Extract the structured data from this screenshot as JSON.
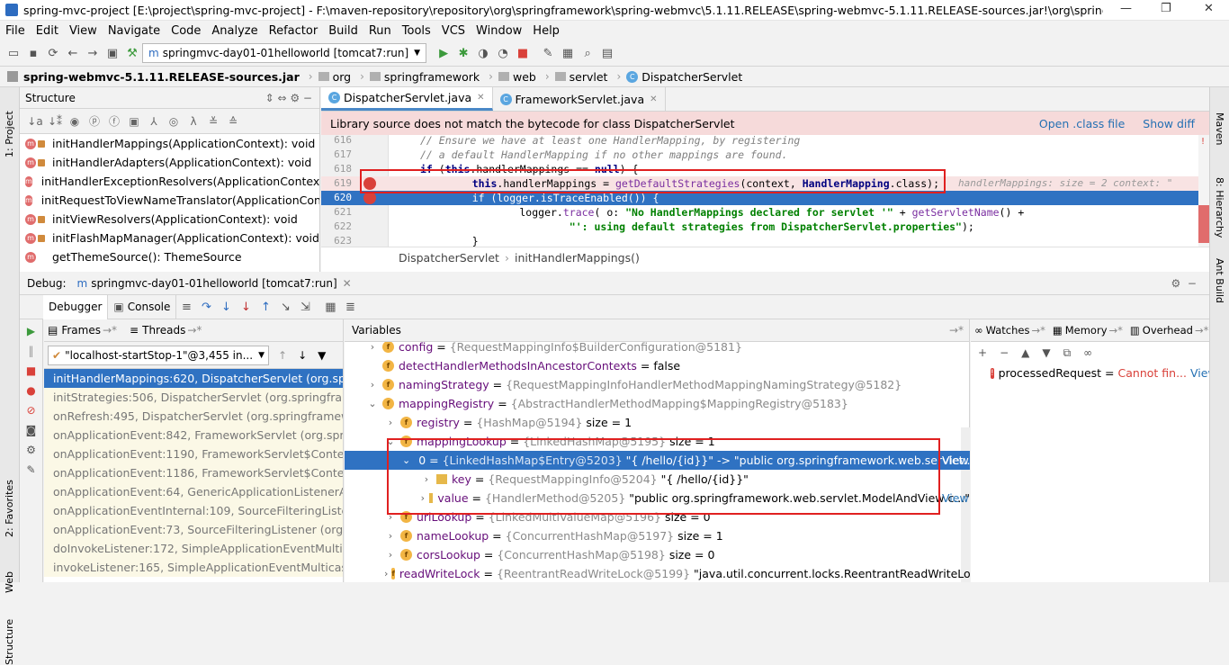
{
  "window": {
    "title": "spring-mvc-project [E:\\project\\spring-mvc-project] - F:\\maven-repository\\repository\\org\\springframework\\spring-webmvc\\5.1.11.RELEASE\\spring-webmvc-5.1.11.RELEASE-sources.jar!\\org\\springframewor...",
    "minimize": "—",
    "maximize": "❐",
    "close": "✕"
  },
  "menu": [
    "File",
    "Edit",
    "View",
    "Navigate",
    "Code",
    "Analyze",
    "Refactor",
    "Build",
    "Run",
    "Tools",
    "VCS",
    "Window",
    "Help"
  ],
  "toolbar": {
    "run_config": "springmvc-day01-01helloworld [tomcat7:run]"
  },
  "nav": {
    "jar": "spring-webmvc-5.1.11.RELEASE-sources.jar",
    "crumbs": [
      "org",
      "springframework",
      "web",
      "servlet",
      "DispatcherServlet"
    ]
  },
  "left_strip": {
    "project": "1: Project",
    "favorites": "2: Favorites",
    "web": "Web",
    "structure": "Structure"
  },
  "right_strip": {
    "maven": "Maven",
    "hierarchy": "8: Hierarchy",
    "ant": "Ant Build"
  },
  "structure": {
    "title": "Structure",
    "items": [
      "initHandlerMappings(ApplicationContext): void",
      "initHandlerAdapters(ApplicationContext): void",
      "initHandlerExceptionResolvers(ApplicationContext):",
      "initRequestToViewNameTranslator(ApplicationConte",
      "initViewResolvers(ApplicationContext): void",
      "initFlashMapManager(ApplicationContext): void",
      "getThemeSource(): ThemeSource"
    ]
  },
  "editor": {
    "tabs": [
      "DispatcherServlet.java",
      "FrameworkServlet.java"
    ],
    "banner": "Library source does not match the bytecode for class DispatcherServlet",
    "banner_links": [
      "Open .class file",
      "Show diff"
    ],
    "line_numbers": [
      "616",
      "617",
      "618",
      "619",
      "620",
      "621",
      "622",
      "623"
    ],
    "lines": [
      {
        "parts": [
          {
            "c": "cm",
            "t": "// Ensure we have at least one HandlerMapping, by registering"
          }
        ]
      },
      {
        "parts": [
          {
            "c": "cm",
            "t": "// a default HandlerMapping if no other mappings are found."
          }
        ]
      },
      {
        "parts": [
          {
            "c": "kw",
            "t": "if"
          },
          {
            "c": "",
            "t": " ("
          },
          {
            "c": "kw",
            "t": "this"
          },
          {
            "c": "",
            "t": ".handlerMappings == "
          },
          {
            "c": "kw",
            "t": "null"
          },
          {
            "c": "",
            "t": ") {"
          }
        ]
      },
      {
        "parts": [
          {
            "c": "",
            "t": "    "
          },
          {
            "c": "kw",
            "t": "this"
          },
          {
            "c": "",
            "t": ".handlerMappings = "
          },
          {
            "c": "fn",
            "t": "getDefaultStrategies"
          },
          {
            "c": "",
            "t": "(context, "
          },
          {
            "c": "kw",
            "t": "HandlerMapping"
          },
          {
            "c": "",
            "t": ".class);"
          }
        ]
      },
      {
        "parts": [
          {
            "c": "",
            "t": "    if (logger.isTraceEnabled()) {"
          }
        ]
      },
      {
        "parts": [
          {
            "c": "",
            "t": "        logger."
          },
          {
            "c": "fn",
            "t": "trace"
          },
          {
            "c": "",
            "t": "( o: "
          },
          {
            "c": "str",
            "t": "\"No HandlerMappings declared for servlet '\""
          },
          {
            "c": "",
            "t": " + "
          },
          {
            "c": "fn",
            "t": "getServletName"
          },
          {
            "c": "",
            "t": "() +"
          }
        ]
      },
      {
        "parts": [
          {
            "c": "str",
            "t": "                \"': using default strategies from DispatcherServlet.properties\""
          },
          {
            "c": "",
            "t": ");"
          }
        ]
      },
      {
        "parts": [
          {
            "c": "",
            "t": "    }"
          }
        ]
      }
    ],
    "inline_hint": "handlerMappings:  size = 2   context: \"",
    "breadcrumb": [
      "DispatcherServlet",
      "initHandlerMappings()"
    ]
  },
  "debug": {
    "label": "Debug:",
    "config": "springmvc-day01-01helloworld [tomcat7:run]",
    "tabs": [
      "Debugger",
      "Console"
    ],
    "frames_tab": "Frames",
    "threads_tab": "Threads",
    "thread": "\"localhost-startStop-1\"@3,455 in...",
    "frames": [
      "initHandlerMappings:620, DispatcherServlet (org.springf",
      "initStrategies:506, DispatcherServlet (org.springframew",
      "onRefresh:495, DispatcherServlet (org.springframework",
      "onApplicationEvent:842, FrameworkServlet (org.springfr",
      "onApplicationEvent:1190, FrameworkServlet$ContextRef",
      "onApplicationEvent:1186, FrameworkServlet$ContextRef",
      "onApplicationEvent:64, GenericApplicationListenerAdapt",
      "onApplicationEventInternal:109, SourceFilteringListener",
      "onApplicationEvent:73, SourceFilteringListener (org.sprin",
      "doInvokeListener:172, SimpleApplicationEventMulticaste",
      "invokeListener:165, SimpleApplicationEventMulticaster"
    ],
    "variables_title": "Variables",
    "variables": [
      {
        "arrow": "›",
        "icon": "f",
        "name": "config",
        "type": "{RequestMappingInfo$BuilderConfiguration@5181}",
        "val": ""
      },
      {
        "arrow": "",
        "icon": "f",
        "name": "detectHandlerMethodsInAncestorContexts",
        "type": "",
        "val": "false"
      },
      {
        "arrow": "›",
        "icon": "f",
        "name": "namingStrategy",
        "type": "{RequestMappingInfoHandlerMethodMappingNamingStrategy@5182}",
        "val": ""
      },
      {
        "arrow": "⌄",
        "icon": "f",
        "name": "mappingRegistry",
        "type": "{AbstractHandlerMethodMapping$MappingRegistry@5183}",
        "val": ""
      },
      {
        "arrow": "›",
        "icon": "f",
        "name": "registry",
        "type": "{HashMap@5194}",
        "val": " size = 1"
      },
      {
        "arrow": "⌄",
        "icon": "f",
        "name": "mappingLookup",
        "type": "{LinkedHashMap@5195}",
        "val": " size = 1"
      },
      {
        "arrow": "⌄",
        "icon": "l",
        "name": "0",
        "type": "{LinkedHashMap$Entry@5203}",
        "val": " \"{ /hello/{id}}\" -> \"public org.springframework.web.servlet....\""
      },
      {
        "arrow": "›",
        "icon": "l",
        "name": "key",
        "type": "{RequestMappingInfo@5204}",
        "val": " \"{ /hello/{id}}\""
      },
      {
        "arrow": "›",
        "icon": "l",
        "name": "value",
        "type": "{HandlerMethod@5205}",
        "val": " \"public org.springframework.web.servlet.ModelAndView c...\""
      },
      {
        "arrow": "›",
        "icon": "f",
        "name": "urlLookup",
        "type": "{LinkedMultiValueMap@5196}",
        "val": " size = 0"
      },
      {
        "arrow": "›",
        "icon": "f",
        "name": "nameLookup",
        "type": "{ConcurrentHashMap@5197}",
        "val": " size = 1"
      },
      {
        "arrow": "›",
        "icon": "f",
        "name": "corsLookup",
        "type": "{ConcurrentHashMap@5198}",
        "val": " size = 0"
      },
      {
        "arrow": "›",
        "icon": "f",
        "name": "readWriteLock",
        "type": "{ReentrantReadWriteLock@5199}",
        "val": " \"java.util.concurrent.locks.ReentrantReadWriteLock@7\""
      }
    ],
    "view_link": "View",
    "watches_tabs": [
      "Watches",
      "Memory",
      "Overhead"
    ],
    "watch": {
      "name": "processedRequest",
      "value": "Cannot fin...",
      "link": "View"
    }
  }
}
